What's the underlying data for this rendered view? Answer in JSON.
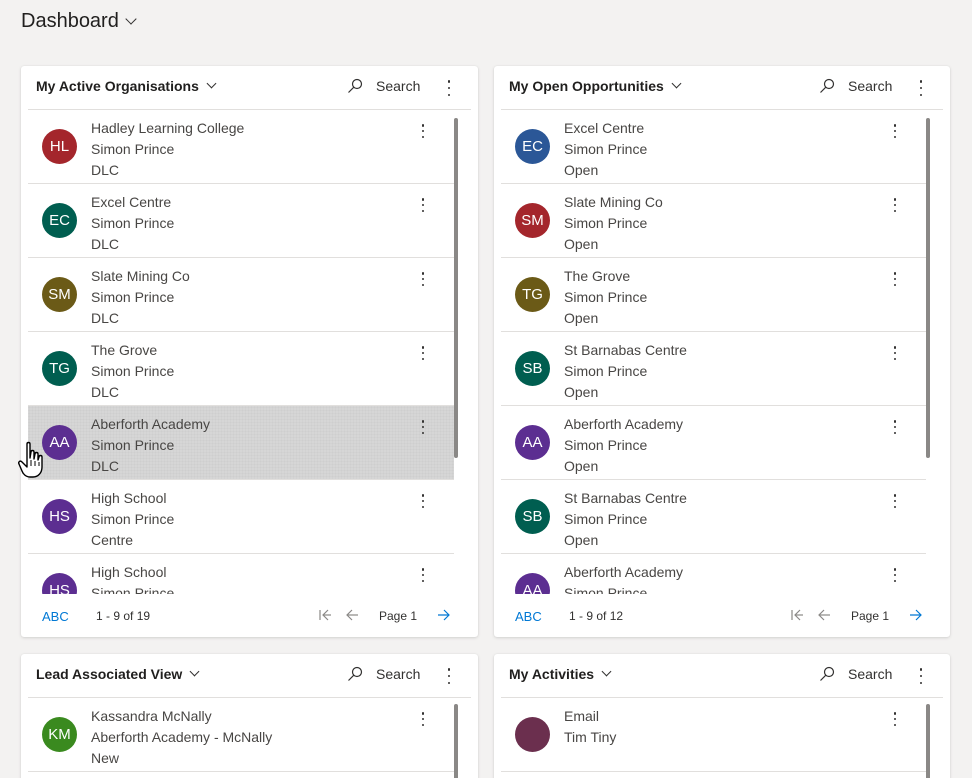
{
  "header": {
    "title": "Dashboard"
  },
  "panels": [
    {
      "title": "My Active Organisations",
      "search_label": "Search",
      "items": [
        {
          "initials": "HL",
          "color": "#a4262c",
          "line1": "Hadley Learning College",
          "line2": "Simon Prince",
          "line3": "DLC"
        },
        {
          "initials": "EC",
          "color": "#005e50",
          "line1": "Excel Centre",
          "line2": "Simon Prince",
          "line3": "DLC"
        },
        {
          "initials": "SM",
          "color": "#6b5a17",
          "line1": "Slate Mining Co",
          "line2": "Simon Prince",
          "line3": "DLC"
        },
        {
          "initials": "TG",
          "color": "#005e50",
          "line1": "The Grove",
          "line2": "Simon Prince",
          "line3": "DLC"
        },
        {
          "initials": "AA",
          "color": "#5c2e91",
          "line1": "Aberforth Academy",
          "line2": "Simon Prince",
          "line3": "DLC",
          "selected": true
        },
        {
          "initials": "HS",
          "color": "#5c2e91",
          "line1": "High School",
          "line2": "Simon Prince",
          "line3": "Centre"
        },
        {
          "initials": "HS",
          "color": "#5c2e91",
          "line1": "High School",
          "line2": "Simon Prince",
          "line3": ""
        }
      ],
      "footer": {
        "abc": "ABC",
        "count": "1 - 9 of 19",
        "page": "Page 1"
      }
    },
    {
      "title": "My Open Opportunities",
      "search_label": "Search",
      "items": [
        {
          "initials": "EC",
          "color": "#2b5797",
          "line1": "Excel Centre",
          "line2": "Simon Prince",
          "line3": "Open"
        },
        {
          "initials": "SM",
          "color": "#a4262c",
          "line1": "Slate Mining Co",
          "line2": "Simon Prince",
          "line3": "Open"
        },
        {
          "initials": "TG",
          "color": "#6b5a17",
          "line1": "The Grove",
          "line2": "Simon Prince",
          "line3": "Open"
        },
        {
          "initials": "SB",
          "color": "#005e50",
          "line1": "St Barnabas Centre",
          "line2": "Simon Prince",
          "line3": "Open"
        },
        {
          "initials": "AA",
          "color": "#5c2e91",
          "line1": "Aberforth Academy",
          "line2": "Simon Prince",
          "line3": "Open"
        },
        {
          "initials": "SB",
          "color": "#005e50",
          "line1": "St Barnabas Centre",
          "line2": "Simon Prince",
          "line3": "Open"
        },
        {
          "initials": "AA",
          "color": "#5c2e91",
          "line1": "Aberforth Academy",
          "line2": "Simon Prince",
          "line3": ""
        }
      ],
      "footer": {
        "abc": "ABC",
        "count": "1 - 9 of 12",
        "page": "Page 1"
      }
    },
    {
      "title": "Lead Associated View",
      "search_label": "Search",
      "items": [
        {
          "initials": "KM",
          "color": "#3a8a1f",
          "line1": "Kassandra McNally",
          "line2": "Aberforth Academy - McNally",
          "line3": "New"
        }
      ]
    },
    {
      "title": "My Activities",
      "search_label": "Search",
      "items": [
        {
          "initials": "",
          "color": "#6b2f4e",
          "line1": "Email",
          "line2": "Tim Tiny",
          "line3": ""
        }
      ]
    }
  ]
}
